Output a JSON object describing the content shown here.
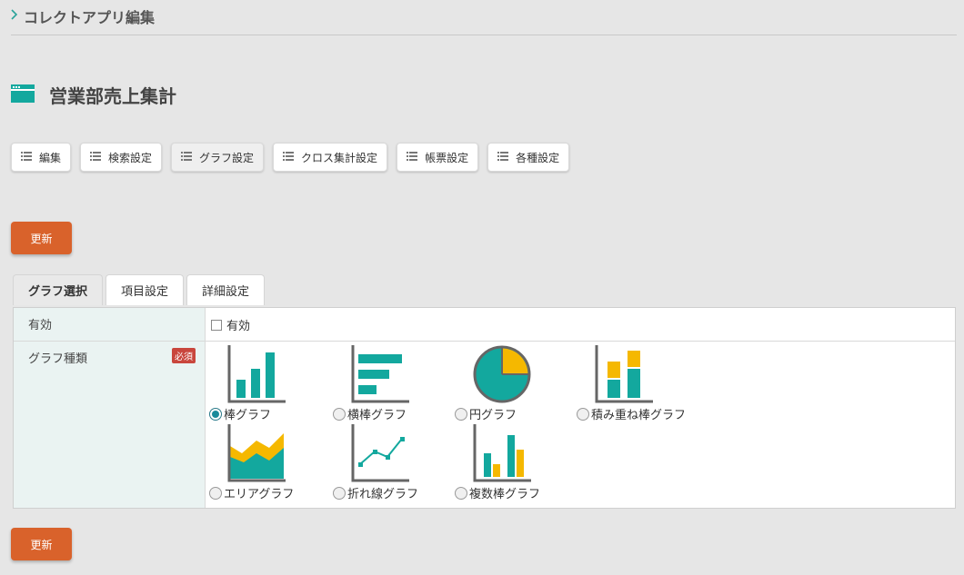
{
  "breadcrumb": {
    "chevron": "›",
    "text": "コレクトアプリ編集"
  },
  "page": {
    "title": "営業部売上集計",
    "icon": "window-icon"
  },
  "toolbar": [
    {
      "label": "編集",
      "icon": "list-icon",
      "active": false
    },
    {
      "label": "検索設定",
      "icon": "list-icon",
      "active": false
    },
    {
      "label": "グラフ設定",
      "icon": "list-icon",
      "active": true
    },
    {
      "label": "クロス集計設定",
      "icon": "list-icon",
      "active": false
    },
    {
      "label": "帳票設定",
      "icon": "list-icon",
      "active": false
    },
    {
      "label": "各種設定",
      "icon": "list-icon",
      "active": false
    }
  ],
  "update_top": "更新",
  "update_bottom": "更新",
  "tabs": [
    {
      "label": "グラフ選択",
      "active": true
    },
    {
      "label": "項目設定",
      "active": false
    },
    {
      "label": "詳細設定",
      "active": false
    }
  ],
  "form": {
    "enabled_label": "有効",
    "enabled_checkbox_label": "有効",
    "enabled_checked": false,
    "chart_type_label": "グラフ種類",
    "required_badge": "必須",
    "options": [
      {
        "label": "棒グラフ",
        "icon": "bar-chart-icon",
        "selected": true
      },
      {
        "label": "横棒グラフ",
        "icon": "horizontal-bar-chart-icon",
        "selected": false
      },
      {
        "label": "円グラフ",
        "icon": "pie-chart-icon",
        "selected": false
      },
      {
        "label": "積み重ね棒グラフ",
        "icon": "stacked-bar-chart-icon",
        "selected": false
      },
      {
        "label": "エリアグラフ",
        "icon": "area-chart-icon",
        "selected": false
      },
      {
        "label": "折れ線グラフ",
        "icon": "line-chart-icon",
        "selected": false
      },
      {
        "label": "複数棒グラフ",
        "icon": "multi-bar-chart-icon",
        "selected": false
      }
    ]
  },
  "colors": {
    "accent": "#d9622b",
    "teal": "#13a89e",
    "yellow": "#f5b800",
    "label_bg": "#eaf3f2",
    "required": "#c9463d"
  }
}
